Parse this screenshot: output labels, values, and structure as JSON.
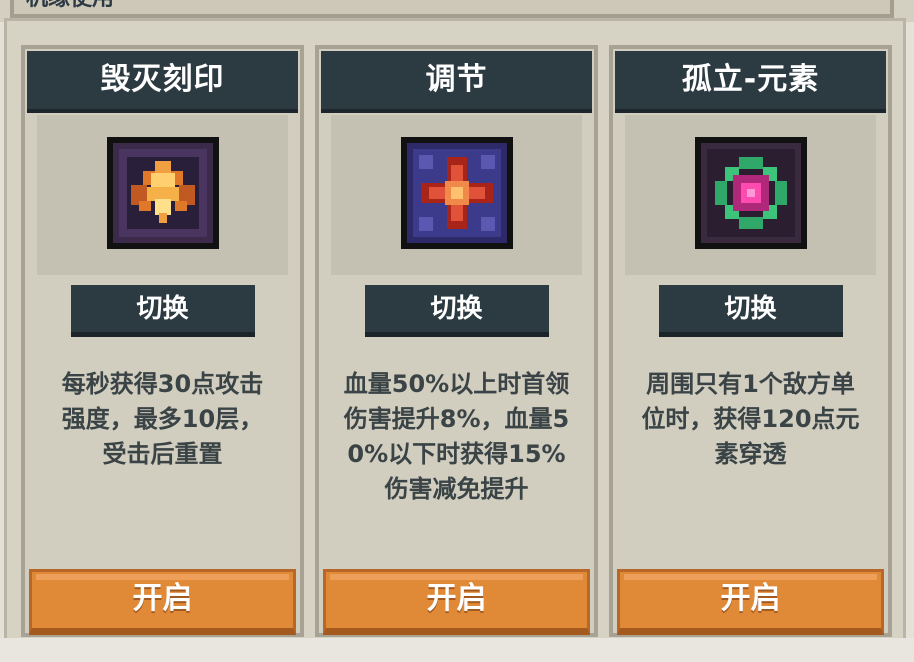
{
  "page": {
    "section_title": "机缘使用"
  },
  "cards": [
    {
      "title": "毁灭刻印",
      "icon": "destruction-mark-icon",
      "switch_label": "切换",
      "description_lines": [
        "每秒获得30点攻击",
        "强度，最多10层，",
        "受击后重置"
      ],
      "open_label": "开启"
    },
    {
      "title": "调节",
      "icon": "regulation-icon",
      "switch_label": "切换",
      "description_lines": [
        "血量50%以上时首领",
        "伤害提升8%，血量5",
        "0%以下时获得15%",
        "伤害减免提升"
      ],
      "open_label": "开启"
    },
    {
      "title": "孤立-元素",
      "icon": "isolation-element-icon",
      "switch_label": "切换",
      "description_lines": [
        "周围只有1个敌方单",
        "位时，获得120点元",
        "素穿透"
      ],
      "open_label": "开启"
    }
  ],
  "colors": {
    "header_bg": "#2c3a42",
    "button_orange": "#e08a38",
    "card_bg": "#d1cdbf",
    "text_dark": "#3a4346"
  }
}
